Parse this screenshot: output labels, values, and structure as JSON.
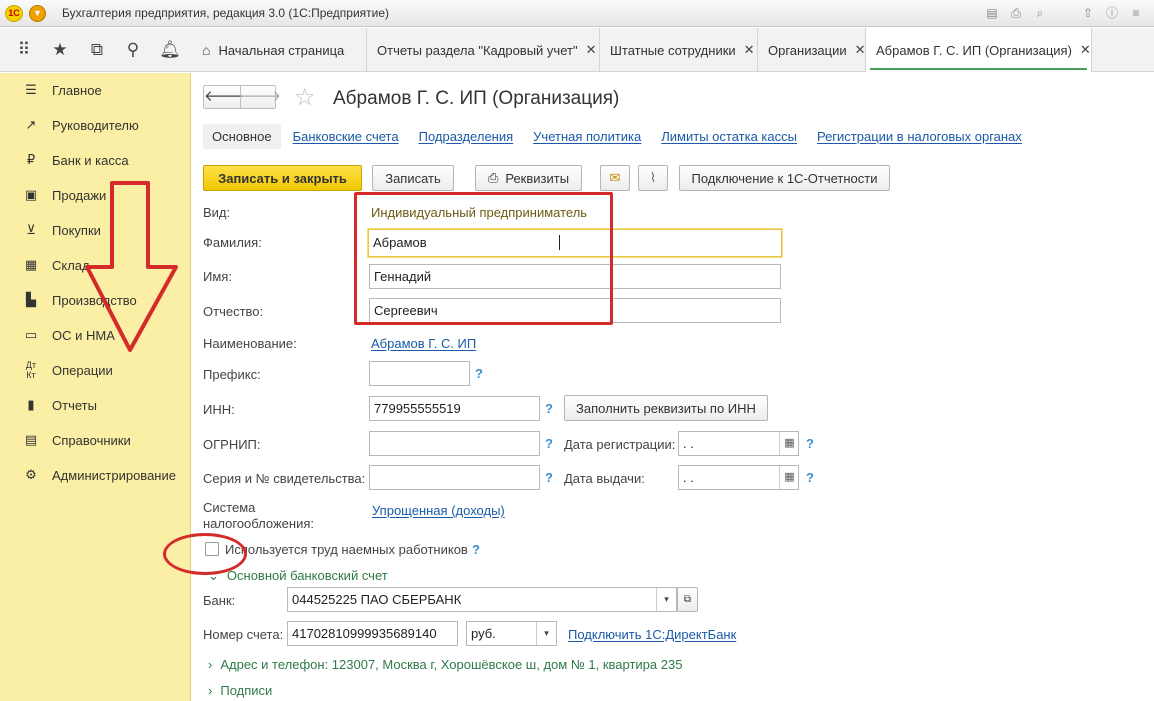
{
  "window": {
    "title": "Бухгалтерия предприятия, редакция 3.0  (1С:Предприятие)",
    "logo_text": "1С"
  },
  "tabs": [
    {
      "label": "Начальная страница"
    },
    {
      "label": "Отчеты раздела \"Кадровый учет\""
    },
    {
      "label": "Штатные сотрудники"
    },
    {
      "label": "Организации"
    },
    {
      "label": "Абрамов Г. С. ИП (Организация)"
    }
  ],
  "sidebar": {
    "items": [
      {
        "label": "Главное",
        "icon": "menu-lines-icon"
      },
      {
        "label": "Руководителю",
        "icon": "trend-chart-icon"
      },
      {
        "label": "Банк и касса",
        "icon": "ruble-coin-icon"
      },
      {
        "label": "Продажи",
        "icon": "shopping-bag-icon"
      },
      {
        "label": "Покупки",
        "icon": "cart-icon"
      },
      {
        "label": "Склад",
        "icon": "warehouse-icon"
      },
      {
        "label": "Производство",
        "icon": "factory-icon"
      },
      {
        "label": "ОС и НМА",
        "icon": "building-icon"
      },
      {
        "label": "Операции",
        "icon": "dt-kt-icon"
      },
      {
        "label": "Отчеты",
        "icon": "bar-chart-icon"
      },
      {
        "label": "Справочники",
        "icon": "book-icon"
      },
      {
        "label": "Администрирование",
        "icon": "gear-icon"
      }
    ]
  },
  "form": {
    "title": "Абрамов Г. С. ИП (Организация)",
    "links": {
      "current": "Основное",
      "items": [
        "Банковские счета",
        "Подразделения",
        "Учетная политика",
        "Лимиты остатка кассы",
        "Регистрации в налоговых органах"
      ]
    },
    "toolbar": {
      "save_close": "Записать и закрыть",
      "save": "Записать",
      "requisites": "Реквизиты",
      "connect": "Подключение к 1С-Отчетности"
    },
    "fields": {
      "vid_label": "Вид:",
      "vid_value": "Индивидуальный предприниматель",
      "surname_label": "Фамилия:",
      "surname_value": "Абрамов",
      "name_label": "Имя:",
      "name_value": "Геннадий",
      "patronymic_label": "Отчество:",
      "patronymic_value": "Сергеевич",
      "naming_label": "Наименование:",
      "naming_value": "Абрамов Г. С. ИП",
      "prefix_label": "Префикс:",
      "prefix_value": "",
      "inn_label": "ИНН:",
      "inn_value": "779955555519",
      "fill_by_inn": "Заполнить реквизиты по ИНН",
      "ogrnip_label": "ОГРНИП:",
      "ogrnip_value": "",
      "reg_date_label": "Дата регистрации:",
      "reg_date_value": " .  .",
      "cert_label": "Серия и № свидетельства:",
      "cert_value": "",
      "issue_date_label": "Дата выдачи:",
      "issue_date_value": " .  .",
      "tax_label_1": "Система",
      "tax_label_2": "налогообложения:",
      "tax_value": "Упрощенная (доходы)",
      "employees_label": "Используется труд наемных работников",
      "employees_checked": false,
      "help_mark": "?"
    },
    "bank_section": {
      "title": "Основной банковский счет",
      "bank_label": "Банк:",
      "bank_value": "044525225 ПАО СБЕРБАНК",
      "account_label": "Номер счета:",
      "account_value": "41702810999935689140",
      "currency_value": "руб.",
      "direct_bank_link": "Подключить 1С:ДиректБанк"
    },
    "address_section": "Адрес и телефон: 123007, Москва г, Хорошёвское ш, дом № 1, квартира 235",
    "signatures_section": "Подписи"
  },
  "colors": {
    "sidebar_bg": "#fbefa5",
    "primary_button": "#f5d000",
    "link": "#1a5aa8",
    "annotation_red": "#d42a2a",
    "group_green": "#2f7a4a"
  }
}
